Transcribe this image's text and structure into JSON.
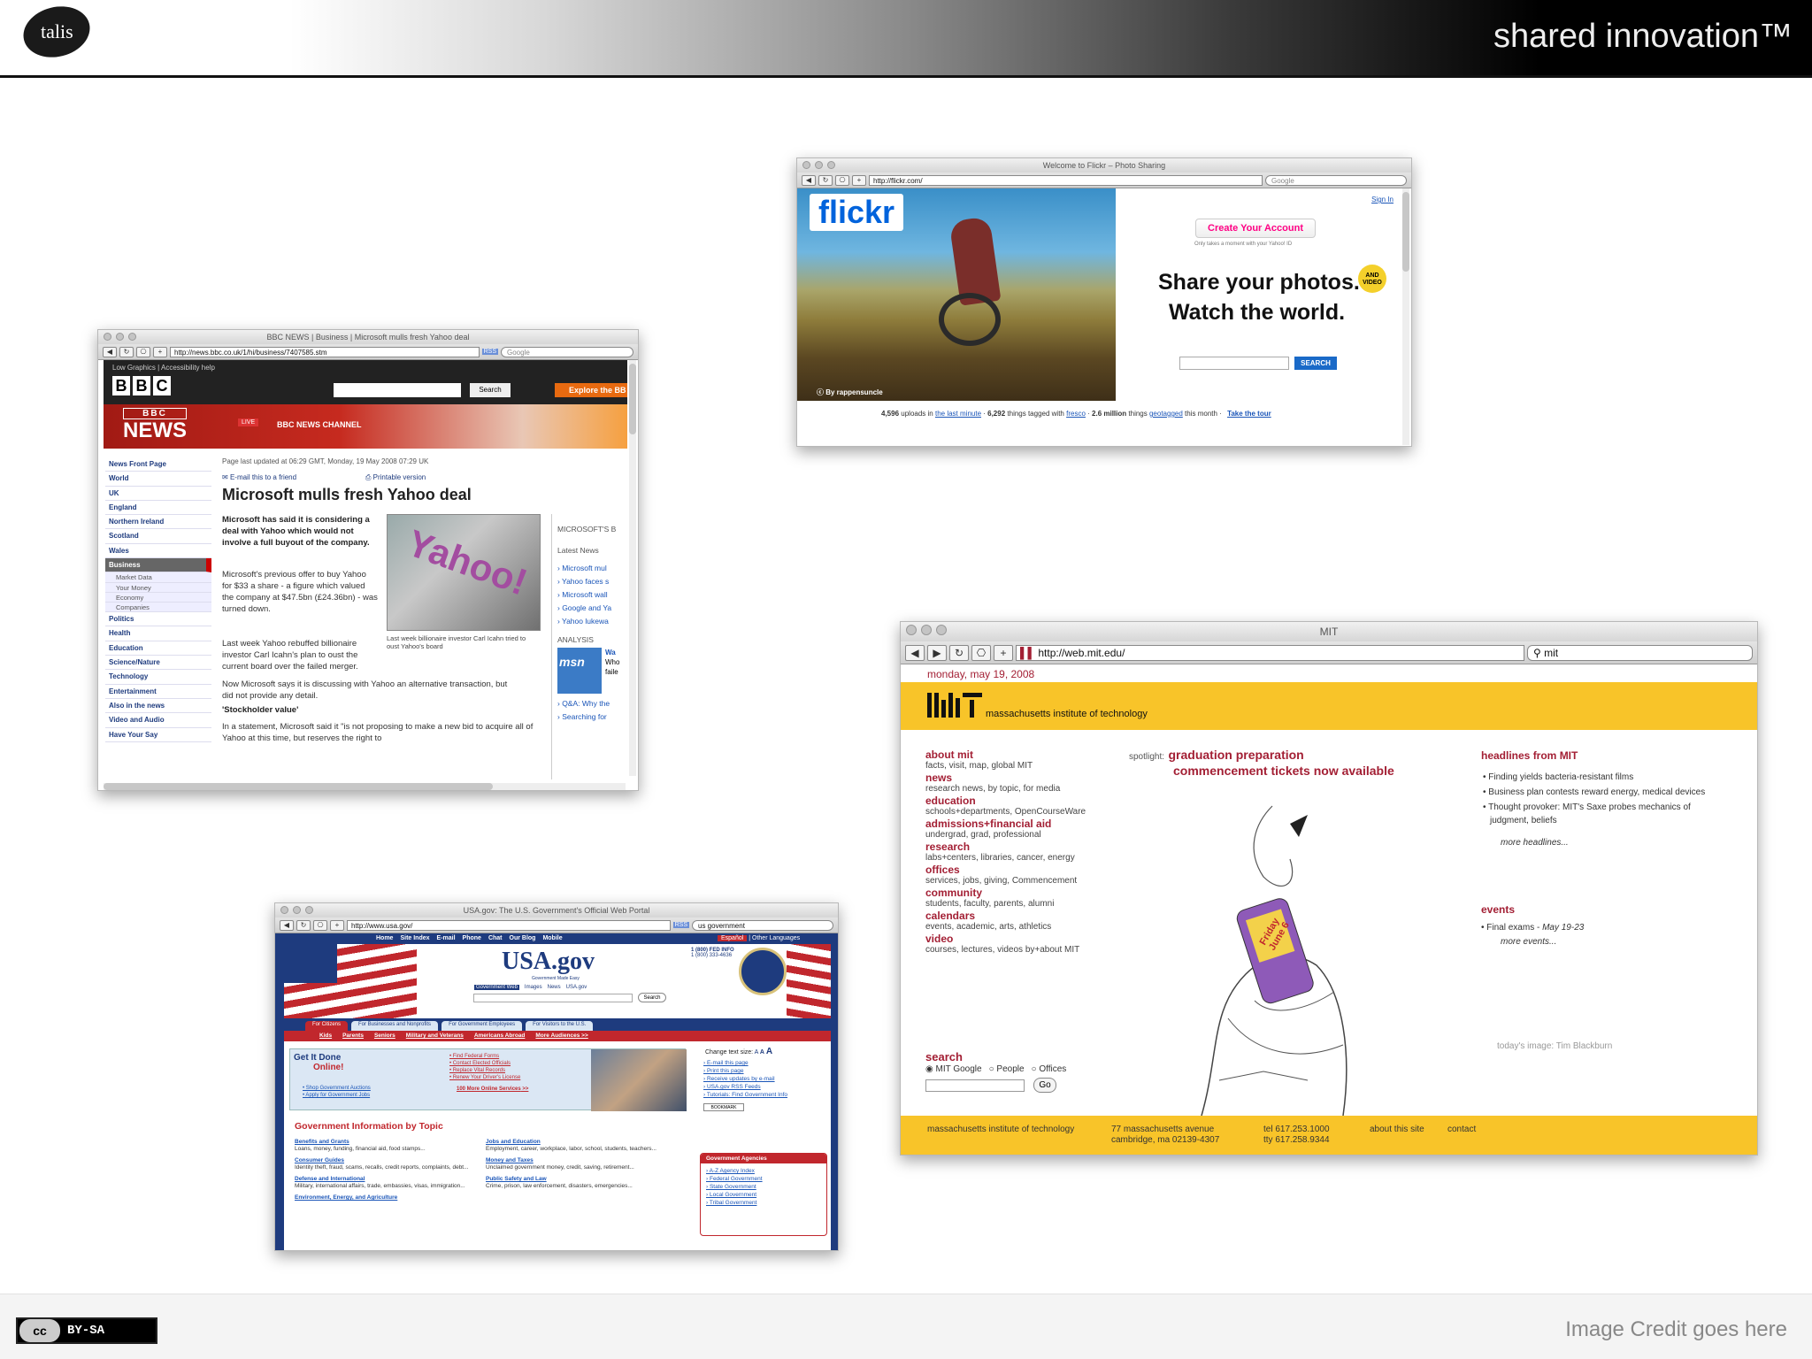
{
  "slide": {
    "logo_text": "talis",
    "tagline": "shared innovation™",
    "license": "BY-SA",
    "cc_label": "cc",
    "credit": "Image Credit goes here"
  },
  "flickr": {
    "title": "Welcome to Flickr – Photo Sharing",
    "url": "http://flickr.com/",
    "search": "Google",
    "logo": "flickr",
    "signin": "Sign In",
    "create": "Create Your Account",
    "create_sub": "Only takes a moment with your Yahoo! ID",
    "headline1": "Share your photos.",
    "headline2": "Watch the world.",
    "badge": "AND VIDEO",
    "search_btn": "SEARCH",
    "photo_credit": "By rappensuncle",
    "stats_1": "4,596",
    "stats_2": "uploads in",
    "stats_3": "the last minute",
    "stats_4": "6,292",
    "stats_5": "things tagged with",
    "stats_6": "fresco",
    "stats_7": "2.6 million",
    "stats_8": "things",
    "stats_9": "geotagged",
    "stats_10": "this month",
    "tour": "Take the tour"
  },
  "bbc": {
    "title": "BBC NEWS | Business | Microsoft mulls fresh Yahoo deal",
    "url": "http://news.bbc.co.uk/1/hi/business/7407585.stm",
    "search": "Google",
    "rss": "RSS",
    "top_links": "Low Graphics | Accessibility help",
    "search_btn": "Search",
    "explore": "Explore the BB",
    "brand": "BBC",
    "news": "NEWS",
    "live": "LIVE",
    "channel": "BBC NEWS CHANNEL",
    "nav": [
      "News Front Page",
      "World",
      "UK",
      "England",
      "Northern Ireland",
      "Scotland",
      "Wales",
      "Business",
      "Market Data",
      "Your Money",
      "Economy",
      "Companies",
      "Politics",
      "Health",
      "Education",
      "Science/Nature",
      "Technology",
      "Entertainment",
      "Also in the news",
      "Video and Audio",
      "Have Your Say"
    ],
    "updated": "Page last updated at 06:29 GMT, Monday, 19 May 2008 07:29 UK",
    "email": "E-mail this to a friend",
    "print": "Printable version",
    "headline": "Microsoft mulls fresh Yahoo deal",
    "lead": "Microsoft has said it is considering a deal with Yahoo which would not involve a full buyout of the company.",
    "p1": "Microsoft's previous offer to buy Yahoo for $33 a share - a figure which valued the company at $47.5bn (£24.36bn) - was turned down.",
    "p2": "Last week Yahoo rebuffed billionaire investor Carl Icahn's plan to oust the current board over the failed merger.",
    "p3": "Now Microsoft says it is discussing with Yahoo an alternative transaction, but did not provide any detail.",
    "subhead": "'Stockholder value'",
    "p4": "In a statement, Microsoft said it \"is not proposing to make a new bid to acquire all of Yahoo at this time, but reserves the right to",
    "caption": "Last week billionaire investor Carl Icahn tried to oust Yahoo's board",
    "photo_text": "Yahoo!",
    "side_head": "MICROSOFT'S B",
    "latest": "Latest News",
    "latest_items": [
      "Microsoft mul",
      "Yahoo faces s",
      "Microsoft wall",
      "Google and Ya",
      "Yahoo lukewa"
    ],
    "analysis": "ANALYSIS",
    "msn": "msn",
    "analysis_text": "Wa",
    "analysis_text2": "Who",
    "analysis_text3": "faile",
    "qa": [
      "Q&A: Why the",
      "Searching for"
    ]
  },
  "usa": {
    "title": "USA.gov: The U.S. Government's Official Web Portal",
    "url": "http://www.usa.gov/",
    "search": "us government",
    "rss": "RSS",
    "topnav": [
      "Home",
      "Site Index",
      "E-mail",
      "Phone",
      "Chat",
      "Our Blog",
      "Mobile"
    ],
    "espanol": "Español",
    "other_lang": "Other Languages",
    "logo": "USA.gov",
    "logo_sub": "Government Made Easy",
    "phone_label": "1 (800) FED INFO",
    "phone": "1 (800) 333-4636",
    "search_tabs": [
      "Government Web",
      "Images",
      "News",
      "USA.gov"
    ],
    "search_btn": "Search",
    "tabs": [
      "For Citizens",
      "For Businesses and Nonprofits",
      "For Government Employees",
      "For Visitors to the U.S."
    ],
    "subnav": [
      "Kids",
      "Parents",
      "Seniors",
      "Military and Veterans",
      "Americans Abroad",
      "More Audiences >>"
    ],
    "get_it_done": "Get It Done",
    "online": "Online!",
    "done_links": [
      "Shop Government Auctions",
      "Apply for Government Jobs"
    ],
    "forms_links": [
      "Find Federal Forms",
      "Contact Elected Officials",
      "Replace Vital Records",
      "Renew Your Driver's License"
    ],
    "more_online": "100 More Online Services",
    "text_size": "Change text size:",
    "tools": [
      "E-mail this page",
      "Print this page",
      "Receive updates by e-mail",
      "USA.gov RSS Feeds",
      "Tutorials: Find Government Info"
    ],
    "bookmark": "BOOKMARK",
    "topic_head": "Government Information by Topic",
    "topics": [
      {
        "t": "Benefits and Grants",
        "d": "Loans, money, funding, financial aid, food stamps..."
      },
      {
        "t": "Consumer Guides",
        "d": "Identity theft, fraud, scams, recalls, credit reports, complaints, debt..."
      },
      {
        "t": "Defense and International",
        "d": "Military, international affairs, trade, embassies, visas, immigration..."
      },
      {
        "t": "Environment, Energy, and Agriculture",
        "d": ""
      }
    ],
    "topics2": [
      {
        "t": "Jobs and Education",
        "d": "Employment, career, workplace, labor, school, students, teachers..."
      },
      {
        "t": "Money and Taxes",
        "d": "Unclaimed government money, credit, saving, retirement..."
      },
      {
        "t": "Public Safety and Law",
        "d": "Crime, prison, law enforcement, disasters, emergencies..."
      }
    ],
    "agencies_head": "Government Agencies",
    "agencies": [
      "A-Z Agency Index",
      "Federal Government",
      "State Government",
      "Local Government",
      "Tribal Government"
    ]
  },
  "mit": {
    "title": "MIT",
    "url": "http://web.mit.edu/",
    "search": "mit",
    "date": "monday, may 19, 2008",
    "logo": "MIT",
    "institute": "massachusetts institute of technology",
    "nav": [
      {
        "t": "about mit",
        "d": "facts, visit, map, global MIT"
      },
      {
        "t": "news",
        "d": "research news, by topic, for media"
      },
      {
        "t": "education",
        "d": "schools+departments, OpenCourseWare"
      },
      {
        "t": "admissions+financial aid",
        "d": "undergrad, grad, professional"
      },
      {
        "t": "research",
        "d": "labs+centers, libraries, cancer, energy"
      },
      {
        "t": "offices",
        "d": "services, jobs, giving, Commencement"
      },
      {
        "t": "community",
        "d": "students, faculty, parents, alumni"
      },
      {
        "t": "calendars",
        "d": "events, academic, arts, athletics"
      },
      {
        "t": "video",
        "d": "courses, lectures, videos by+about MIT"
      }
    ],
    "search_head": "search",
    "search_opts": [
      "MIT Google",
      "People",
      "Offices"
    ],
    "go": "Go",
    "spotlight": "spotlight:",
    "spot1": "graduation preparation",
    "spot2": "commencement tickets now available",
    "phone_text": "Friday June 6",
    "headlines_head": "headlines from MIT",
    "headlines": [
      "Finding yields bacteria-resistant films",
      "Business plan contests reward energy, medical devices",
      "Thought provoker: MIT's Saxe probes mechanics of judgment, beliefs"
    ],
    "more_headlines": "more headlines...",
    "events_head": "events",
    "event": "Final exams - ",
    "event_date": "May 19-23",
    "more_events": "more events...",
    "image_credit": "today's image: Tim Blackburn",
    "foot_name": "massachusetts institute of technology",
    "foot_addr1": "77 massachusetts avenue",
    "foot_addr2": "cambridge, ma 02139-4307",
    "foot_tel": "tel 617.253.1000",
    "foot_tty": "tty 617.258.9344",
    "foot_about": "about this site",
    "foot_contact": "contact"
  },
  "colors": {
    "bbc_red": "#b9211b",
    "mit_yellow": "#f8c429",
    "mit_red": "#a31f34",
    "flickr_blue": "#0063dc",
    "flickr_pink": "#ff0084",
    "usa_navy": "#1e3b7e",
    "usa_red": "#c1272d"
  }
}
